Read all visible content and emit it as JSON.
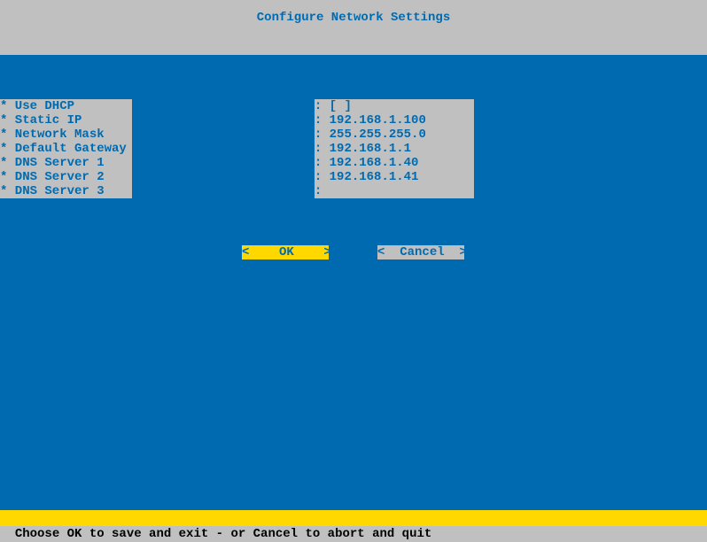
{
  "header": {
    "title": "Configure Network Settings"
  },
  "fields": {
    "dhcp": {
      "label": "* Use DHCP",
      "value": "[ ]"
    },
    "static_ip": {
      "label": "* Static IP",
      "value": "192.168.1.100"
    },
    "netmask": {
      "label": "* Network Mask",
      "value": "255.255.255.0"
    },
    "gateway": {
      "label": "* Default Gateway",
      "value": "192.168.1.1"
    },
    "dns1": {
      "label": "* DNS Server 1",
      "value": "192.168.1.40"
    },
    "dns2": {
      "label": "* DNS Server 2",
      "value": "192.168.1.41"
    },
    "dns3": {
      "label": "* DNS Server 3",
      "value": ""
    }
  },
  "buttons": {
    "ok": "OK",
    "cancel": "Cancel"
  },
  "status": "Choose OK to save and exit - or Cancel to abort and quit"
}
